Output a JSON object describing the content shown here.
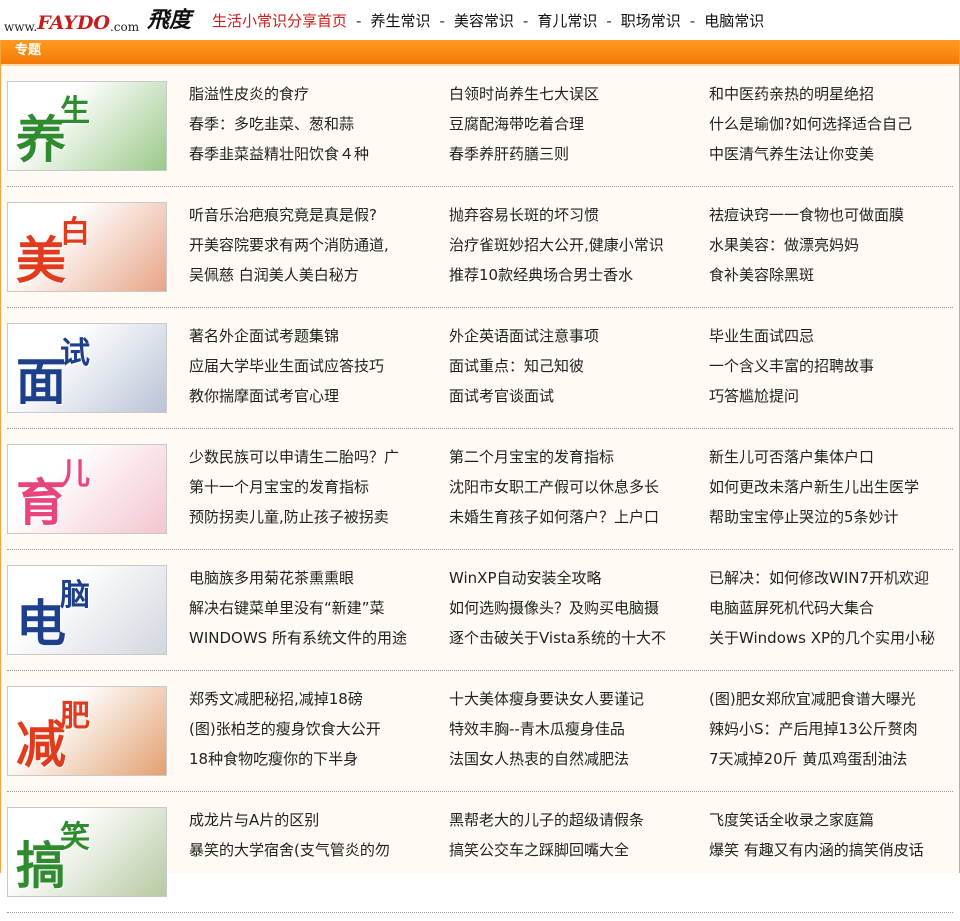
{
  "header": {
    "logo": {
      "prefix": "www.",
      "brand": "FAYDO",
      "suffix": ".com",
      "calligraphy": "飛度"
    },
    "nav": [
      {
        "label": "生活小常识分享首页",
        "active": true
      },
      {
        "label": "养生常识",
        "active": false
      },
      {
        "label": "美容常识",
        "active": false
      },
      {
        "label": "育儿常识",
        "active": false
      },
      {
        "label": "职场常识",
        "active": false
      },
      {
        "label": "电脑常识",
        "active": false
      }
    ],
    "separator": "-"
  },
  "panel": {
    "title": "专题"
  },
  "topics": [
    {
      "name": "养生",
      "chars": [
        "养",
        "生"
      ],
      "accent": "#2e8b2e",
      "bg": "#9bc98a",
      "links": [
        [
          "脂溢性皮炎的食疗",
          "春季：多吃韭菜、葱和蒜",
          "春季韭菜益精壮阳饮食４种"
        ],
        [
          "白领时尚养生七大误区",
          "豆腐配海带吃着合理",
          "春季养肝药膳三则"
        ],
        [
          "和中医药亲热的明星绝招",
          "什么是瑜伽?如何选择适合自己",
          "中医清气养生法让你变美"
        ]
      ]
    },
    {
      "name": "美白",
      "chars": [
        "美",
        "白"
      ],
      "accent": "#e23a1c",
      "bg": "#e8a487",
      "links": [
        [
          "听音乐治疤痕究竟是真是假?",
          "开美容院要求有两个消防通道,",
          "吴佩慈 白润美人美白秘方"
        ],
        [
          "抛弃容易长斑的坏习惯",
          "治疗雀斑妙招大公开,健康小常识",
          "推荐10款经典场合男士香水"
        ],
        [
          "祛痘诀窍一一食物也可做面膜",
          "水果美容：做漂亮妈妈",
          "食补美容除黑斑"
        ]
      ]
    },
    {
      "name": "面试",
      "chars": [
        "面",
        "试"
      ],
      "accent": "#1e3f8c",
      "bg": "#b9c3d6",
      "links": [
        [
          "著名外企面试考题集锦",
          "应届大学毕业生面试应答技巧",
          "教你揣摩面试考官心理"
        ],
        [
          "外企英语面试注意事项",
          "面试重点：知己知彼",
          "面试考官谈面试"
        ],
        [
          "毕业生面试四忌",
          "一个含义丰富的招聘故事",
          "巧答尴尬提问"
        ]
      ]
    },
    {
      "name": "育儿",
      "chars": [
        "育",
        "儿"
      ],
      "accent": "#e8457f",
      "bg": "#f3c5cf",
      "links": [
        [
          "少数民族可以申请生二胎吗？广",
          "第十一个月宝宝的发育指标",
          "预防拐卖儿童,防止孩子被拐卖"
        ],
        [
          "第二个月宝宝的发育指标",
          "沈阳市女职工产假可以休息多长",
          "未婚生育孩子如何落户？上户口"
        ],
        [
          "新生儿可否落户集体户口",
          "如何更改未落户新生儿出生医学",
          "帮助宝宝停止哭泣的5条妙计"
        ]
      ]
    },
    {
      "name": "电脑",
      "chars": [
        "电",
        "脑"
      ],
      "accent": "#1e3f8c",
      "bg": "#d2d6de",
      "links": [
        [
          "电脑族多用菊花茶熏熏眼",
          "解决右键菜单里没有“新建”菜",
          "WINDOWS 所有系统文件的用途"
        ],
        [
          "WinXP自动安装全攻略",
          "如何选购摄像头？及购买电脑摄",
          "逐个击破关于Vista系统的十大不"
        ],
        [
          "已解决：如何修改WIN7开机欢迎",
          "电脑蓝屏死机代码大集合",
          "关于Windows XP的几个实用小秘"
        ]
      ]
    },
    {
      "name": "减肥",
      "chars": [
        "减",
        "肥"
      ],
      "accent": "#e23a1c",
      "bg": "#e2a070",
      "links": [
        [
          "郑秀文减肥秘招,减掉18磅",
          "(图)张柏芝的瘦身饮食大公开",
          "18种食物吃瘦你的下半身"
        ],
        [
          "十大美体瘦身要诀女人要谨记",
          "特效丰胸--青木瓜瘦身佳品",
          "法国女人热衷的自然减肥法"
        ],
        [
          "(图)肥女郑欣宜减肥食谱大曝光",
          "辣妈小S：产后甩掉13公斤赘肉",
          "7天减掉20斤 黄瓜鸡蛋刮油法"
        ]
      ]
    },
    {
      "name": "搞笑",
      "chars": [
        "搞",
        "笑"
      ],
      "accent": "#2e8b2e",
      "bg": "#b7c9a2",
      "links": [
        [
          "成龙片与A片的区别",
          "暴笑的大学宿舍(支气管炎的勿",
          ""
        ],
        [
          "黑帮老大的儿子的超级请假条",
          "搞笑公交车之踩脚回嘴大全",
          ""
        ],
        [
          "飞度笑话全收录之家庭篇",
          "爆笑 有趣又有内涵的搞笑俏皮话",
          ""
        ]
      ]
    }
  ]
}
